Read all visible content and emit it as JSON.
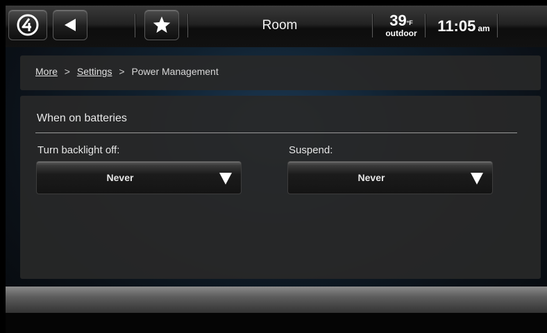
{
  "topbar": {
    "home_icon": "home-logo-icon",
    "back_icon": "back-arrow-icon",
    "favorite_icon": "star-icon",
    "room_label": "Room",
    "temperature": "39",
    "temperature_unit": "°F",
    "temperature_label": "outdoor",
    "time": "11:05",
    "ampm": "am"
  },
  "breadcrumb": {
    "items": [
      "More",
      "Settings",
      "Power Management"
    ],
    "separator": ">"
  },
  "power": {
    "section_title": "When on batteries",
    "backlight_label": "Turn backlight off:",
    "backlight_value": "Never",
    "suspend_label": "Suspend:",
    "suspend_value": "Never"
  },
  "colors": {
    "background_glow": "#1d3a55",
    "panel": "#282828",
    "text": "#e8e8e8"
  }
}
